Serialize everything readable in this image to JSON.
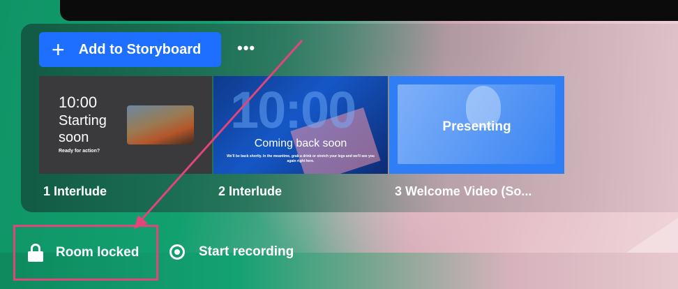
{
  "toolbar": {
    "add_label": "Add to Storyboard",
    "add_icon": "plus-icon",
    "more_label": "•••"
  },
  "thumbnails": [
    {
      "time": "10:00",
      "headline": "Starting soon",
      "tagline": "Ready for action?",
      "caption": "1 Interlude"
    },
    {
      "big_text": "10:00",
      "headline": "Coming back soon",
      "body": "We'll be back shortly. In the meantime, grab a drink or stretch your legs and we'll see you again right here.",
      "caption": "2 Interlude"
    },
    {
      "overlay": "Presenting",
      "caption": "3 Welcome Video (So..."
    }
  ],
  "footer": {
    "lock_label": "Room locked",
    "lock_icon": "lock-icon",
    "record_label": "Start recording",
    "record_icon": "record-icon"
  },
  "colors": {
    "accent_blue": "#1e6fff",
    "highlight_pink": "#e0457b",
    "brand_green": "#0f9466"
  }
}
